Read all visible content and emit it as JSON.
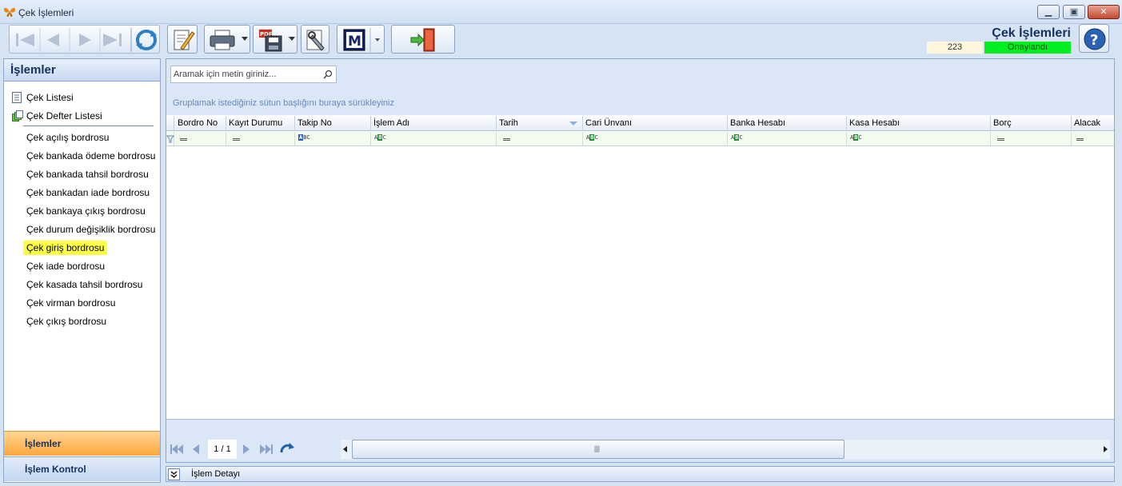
{
  "window": {
    "title": "Çek İşlemleri"
  },
  "header": {
    "title": "Çek İşlemleri",
    "count": "223",
    "status": "Onaylandı",
    "status_color": "#00ee22"
  },
  "toolbar": {
    "buttons": [
      {
        "name": "first-record-icon"
      },
      {
        "name": "previous-record-icon"
      },
      {
        "name": "next-record-icon"
      },
      {
        "name": "last-record-icon"
      },
      {
        "name": "refresh-icon"
      },
      {
        "name": "edit-icon"
      },
      {
        "name": "print-icon"
      },
      {
        "name": "pdf-save-icon"
      },
      {
        "name": "settings-tools-icon"
      },
      {
        "name": "m-logo-icon",
        "label": "M"
      },
      {
        "name": "exit-door-icon"
      }
    ]
  },
  "sidebar": {
    "title": "İşlemler",
    "top_items": [
      {
        "label": "Çek Listesi",
        "icon": "document-list-icon"
      },
      {
        "label": "Çek Defter Listesi",
        "icon": "checkbook-icon"
      }
    ],
    "items": [
      {
        "label": "Çek açılış bordrosu"
      },
      {
        "label": "Çek bankada ödeme bordrosu"
      },
      {
        "label": "Çek bankada tahsil bordrosu"
      },
      {
        "label": "Çek bankadan iade bordrosu"
      },
      {
        "label": "Çek bankaya çıkış bordrosu"
      },
      {
        "label": "Çek durum değişiklik bordrosu"
      },
      {
        "label": "Çek giriş bordrosu",
        "active": true
      },
      {
        "label": "Çek iade bordrosu"
      },
      {
        "label": "Çek kasada tahsil bordrosu"
      },
      {
        "label": "Çek virman bordrosu"
      },
      {
        "label": "Çek çıkış bordrosu"
      }
    ],
    "bottom_tabs": [
      {
        "label": "İşlemler"
      },
      {
        "label": "İşlem Kontrol"
      }
    ],
    "highlight_color": "#ffff46"
  },
  "grid": {
    "search_placeholder": "Aramak için metin giriniz...",
    "group_hint": "Gruplamak istediğiniz sütun başlığını buraya sürükleyiniz",
    "columns": [
      {
        "label": "Bordro No",
        "filter": "equals"
      },
      {
        "label": "Kayıt Durumu",
        "filter": "equals"
      },
      {
        "label": "Takip No",
        "filter": "text-blue"
      },
      {
        "label": "İşlem Adı",
        "filter": "text"
      },
      {
        "label": "Tarih",
        "filter": "equals",
        "sorted": "desc"
      },
      {
        "label": "Cari Ünvanı",
        "filter": "text"
      },
      {
        "label": "Banka Hesabı",
        "filter": "text"
      },
      {
        "label": "Kasa Hesabı",
        "filter": "text"
      },
      {
        "label": "Borç",
        "filter": "equals"
      },
      {
        "label": "Alacak",
        "filter": "equals"
      }
    ],
    "rows": []
  },
  "pager": {
    "page": "1 / 1"
  },
  "detail": {
    "label": "İşlem Detayı"
  }
}
